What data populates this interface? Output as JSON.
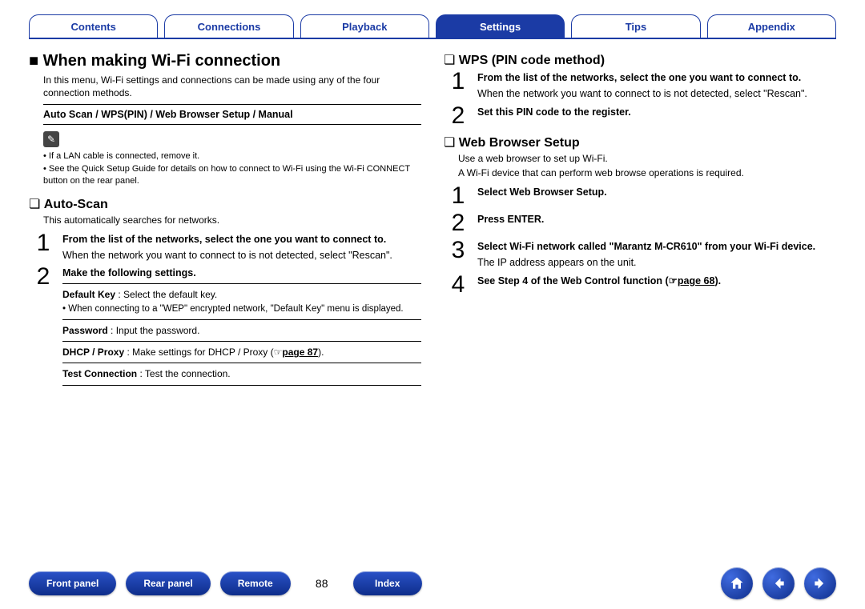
{
  "nav": {
    "tabs": [
      "Contents",
      "Connections",
      "Playback",
      "Settings",
      "Tips",
      "Appendix"
    ],
    "active_index": 3
  },
  "left": {
    "heading": "When making Wi-Fi connection",
    "intro": "In this menu, Wi-Fi settings and connections can be made using any of the four connection methods.",
    "methods_box": "Auto Scan / WPS(PIN) / Web Browser Setup / Manual",
    "note_icon": "✎",
    "notes": [
      "If a LAN cable is connected, remove it.",
      "See the Quick Setup Guide for details on how to connect to Wi-Fi using the Wi-Fi CONNECT button on the rear panel."
    ],
    "autoscan": {
      "title": "Auto-Scan",
      "intro": "This automatically searches for networks.",
      "steps": [
        {
          "num": "1",
          "title": "From the list of the networks, select the one you want to connect to.",
          "body": "When the network you want to connect to is not detected, select \"Rescan\"."
        },
        {
          "num": "2",
          "title": "Make the following settings.",
          "settings": [
            {
              "label": "Default Key",
              "desc": " : Select the default key.",
              "note": "When connecting to a \"WEP\" encrypted network, \"Default Key\" menu is displayed."
            },
            {
              "label": "Password",
              "desc": " : Input the password."
            },
            {
              "label": "DHCP / Proxy",
              "desc": " : Make settings for DHCP / Proxy (",
              "link": "page 87",
              "tail": ")."
            },
            {
              "label": "Test Connection",
              "desc": " : Test the connection."
            }
          ]
        }
      ]
    }
  },
  "right": {
    "wps": {
      "title": "WPS (PIN code method)",
      "steps": [
        {
          "num": "1",
          "title": "From the list of the networks, select the one you want to connect to.",
          "body": "When the network you want to connect to is not detected, select \"Rescan\"."
        },
        {
          "num": "2",
          "title": "Set this PIN code to the register."
        }
      ]
    },
    "web": {
      "title": "Web Browser Setup",
      "intro1": "Use a web browser to set up Wi-Fi.",
      "intro2": "A Wi-Fi device that can perform web browse operations is required.",
      "steps": [
        {
          "num": "1",
          "title": "Select Web Browser Setup."
        },
        {
          "num": "2",
          "title": "Press ENTER."
        },
        {
          "num": "3",
          "title": "Select Wi-Fi network called \"Marantz M-CR610\" from your Wi-Fi device.",
          "body": "The IP address appears on the unit."
        },
        {
          "num": "4",
          "title_pre": "See Step 4 of the Web Control function (",
          "link": "page 68",
          "title_post": ")."
        }
      ]
    }
  },
  "bottom": {
    "buttons": [
      "Front panel",
      "Rear panel",
      "Remote"
    ],
    "page_number": "88",
    "index_label": "Index",
    "icons": {
      "home": "home-icon",
      "prev": "arrow-left-icon",
      "next": "arrow-right-icon"
    }
  },
  "link_hand_glyph": "☞"
}
